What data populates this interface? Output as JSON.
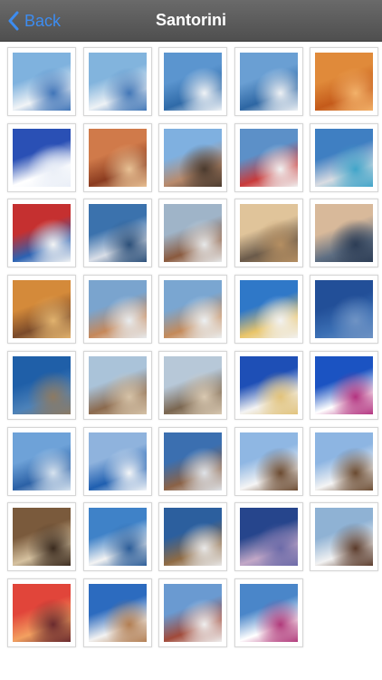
{
  "nav": {
    "back_label": "Back",
    "title": "Santorini"
  },
  "photos": [
    {
      "name": "photo-village-pool",
      "c": [
        "#7fb2de",
        "#f1f4f6",
        "#3f74b8"
      ]
    },
    {
      "name": "photo-village-pool-2",
      "c": [
        "#82b4dd",
        "#eef2f5",
        "#4277b7"
      ]
    },
    {
      "name": "photo-cruise-ships",
      "c": [
        "#5b95cf",
        "#2f6aa8",
        "#f0f3f6"
      ]
    },
    {
      "name": "photo-cruise-ships-2",
      "c": [
        "#6a9fd3",
        "#2d66a3",
        "#eef1f4"
      ]
    },
    {
      "name": "photo-orange-seat",
      "c": [
        "#e08a3a",
        "#c45a1a",
        "#f3b26a"
      ]
    },
    {
      "name": "photo-white-chapel",
      "c": [
        "#2a50b5",
        "#ffffff",
        "#e9eef7"
      ]
    },
    {
      "name": "photo-red-cliffs",
      "c": [
        "#d07a4a",
        "#8a3b1f",
        "#e9c295"
      ]
    },
    {
      "name": "photo-people-statues",
      "c": [
        "#7fb0e0",
        "#b88a6c",
        "#4a3a2e"
      ]
    },
    {
      "name": "photo-flowers-view",
      "c": [
        "#5c90c8",
        "#c93a3a",
        "#f1f2f2"
      ]
    },
    {
      "name": "photo-pool-terrace",
      "c": [
        "#3f7fc2",
        "#d9dce2",
        "#3fa4c9"
      ]
    },
    {
      "name": "photo-flowers-chapel",
      "c": [
        "#c53030",
        "#2c62b2",
        "#f3f4f4"
      ]
    },
    {
      "name": "photo-town-overview",
      "c": [
        "#3b72ad",
        "#d9dee7",
        "#2b4f79"
      ]
    },
    {
      "name": "photo-white-cliff-town",
      "c": [
        "#9fb4c8",
        "#8a5a3e",
        "#e7e9ea"
      ]
    },
    {
      "name": "photo-clouds-sunset",
      "c": [
        "#e0c49a",
        "#6a5a4a",
        "#b58f62"
      ]
    },
    {
      "name": "photo-caldera-clouds",
      "c": [
        "#d8b99a",
        "#5f6f83",
        "#2d3d55"
      ]
    },
    {
      "name": "photo-golden-cliff",
      "c": [
        "#d48a3a",
        "#7a4a2a",
        "#e2b36e"
      ]
    },
    {
      "name": "photo-balcony-view",
      "c": [
        "#7aa4ce",
        "#c6885a",
        "#e8ecef"
      ]
    },
    {
      "name": "photo-balcony-view-2",
      "c": [
        "#7aa6d1",
        "#c48a5a",
        "#ecf0f2"
      ]
    },
    {
      "name": "photo-terrace-sea",
      "c": [
        "#2f78c8",
        "#e9c56a",
        "#f2f2f2"
      ]
    },
    {
      "name": "photo-wire-sea",
      "c": [
        "#224f98",
        "#3b6fb4",
        "#6f93c4"
      ]
    },
    {
      "name": "photo-island-cliff",
      "c": [
        "#1f5fa8",
        "#4d82b9",
        "#8d7a62"
      ]
    },
    {
      "name": "photo-caldera-rim",
      "c": [
        "#aac3d9",
        "#8b6a4e",
        "#d6c3a8"
      ]
    },
    {
      "name": "photo-caldera-rim-2",
      "c": [
        "#b7c8d8",
        "#7a6650",
        "#d9c9b2"
      ]
    },
    {
      "name": "photo-clock-tower",
      "c": [
        "#1e4fb6",
        "#f3f3f3",
        "#e1c27a"
      ]
    },
    {
      "name": "photo-blue-domes-flowers",
      "c": [
        "#1b53c2",
        "#ffffff",
        "#b2327f"
      ]
    },
    {
      "name": "photo-sea-horizon",
      "c": [
        "#6ea2d8",
        "#2b61a6",
        "#d7e3ef"
      ]
    },
    {
      "name": "photo-greek-flag",
      "c": [
        "#8fb3dd",
        "#1f5fb0",
        "#f4f6f8"
      ]
    },
    {
      "name": "photo-aerial-cliffs",
      "c": [
        "#3b6fb0",
        "#8b6246",
        "#dfe3e8"
      ]
    },
    {
      "name": "photo-windmill",
      "c": [
        "#8fb7e3",
        "#f5f5f5",
        "#6b4a30"
      ]
    },
    {
      "name": "photo-windmill-2",
      "c": [
        "#8db5e2",
        "#f4f4f4",
        "#6a4a30"
      ]
    },
    {
      "name": "photo-winding-road",
      "c": [
        "#7a5a3c",
        "#d6c2a0",
        "#3a2a1e"
      ]
    },
    {
      "name": "photo-white-village-sea",
      "c": [
        "#3f82c8",
        "#f3f3f3",
        "#2a5c98"
      ]
    },
    {
      "name": "photo-cliff-village",
      "c": [
        "#2c5f9e",
        "#8f6b44",
        "#e9e9e9"
      ]
    },
    {
      "name": "photo-dusk-village",
      "c": [
        "#26458c",
        "#c3a8c7",
        "#6b6aa8"
      ]
    },
    {
      "name": "photo-cafe-terrace",
      "c": [
        "#8fb2d4",
        "#f2f2f2",
        "#5a3a2a"
      ]
    },
    {
      "name": "photo-red-sunset",
      "c": [
        "#e1453a",
        "#f3a060",
        "#6a2a2e"
      ]
    },
    {
      "name": "photo-church-steps",
      "c": [
        "#2c6bbf",
        "#f2f2f2",
        "#b27e52"
      ]
    },
    {
      "name": "photo-village-alley",
      "c": [
        "#6a9ad1",
        "#a14a3a",
        "#efefef"
      ]
    },
    {
      "name": "photo-domes-sea",
      "c": [
        "#4a86c9",
        "#ffffff",
        "#b0397a"
      ]
    }
  ]
}
